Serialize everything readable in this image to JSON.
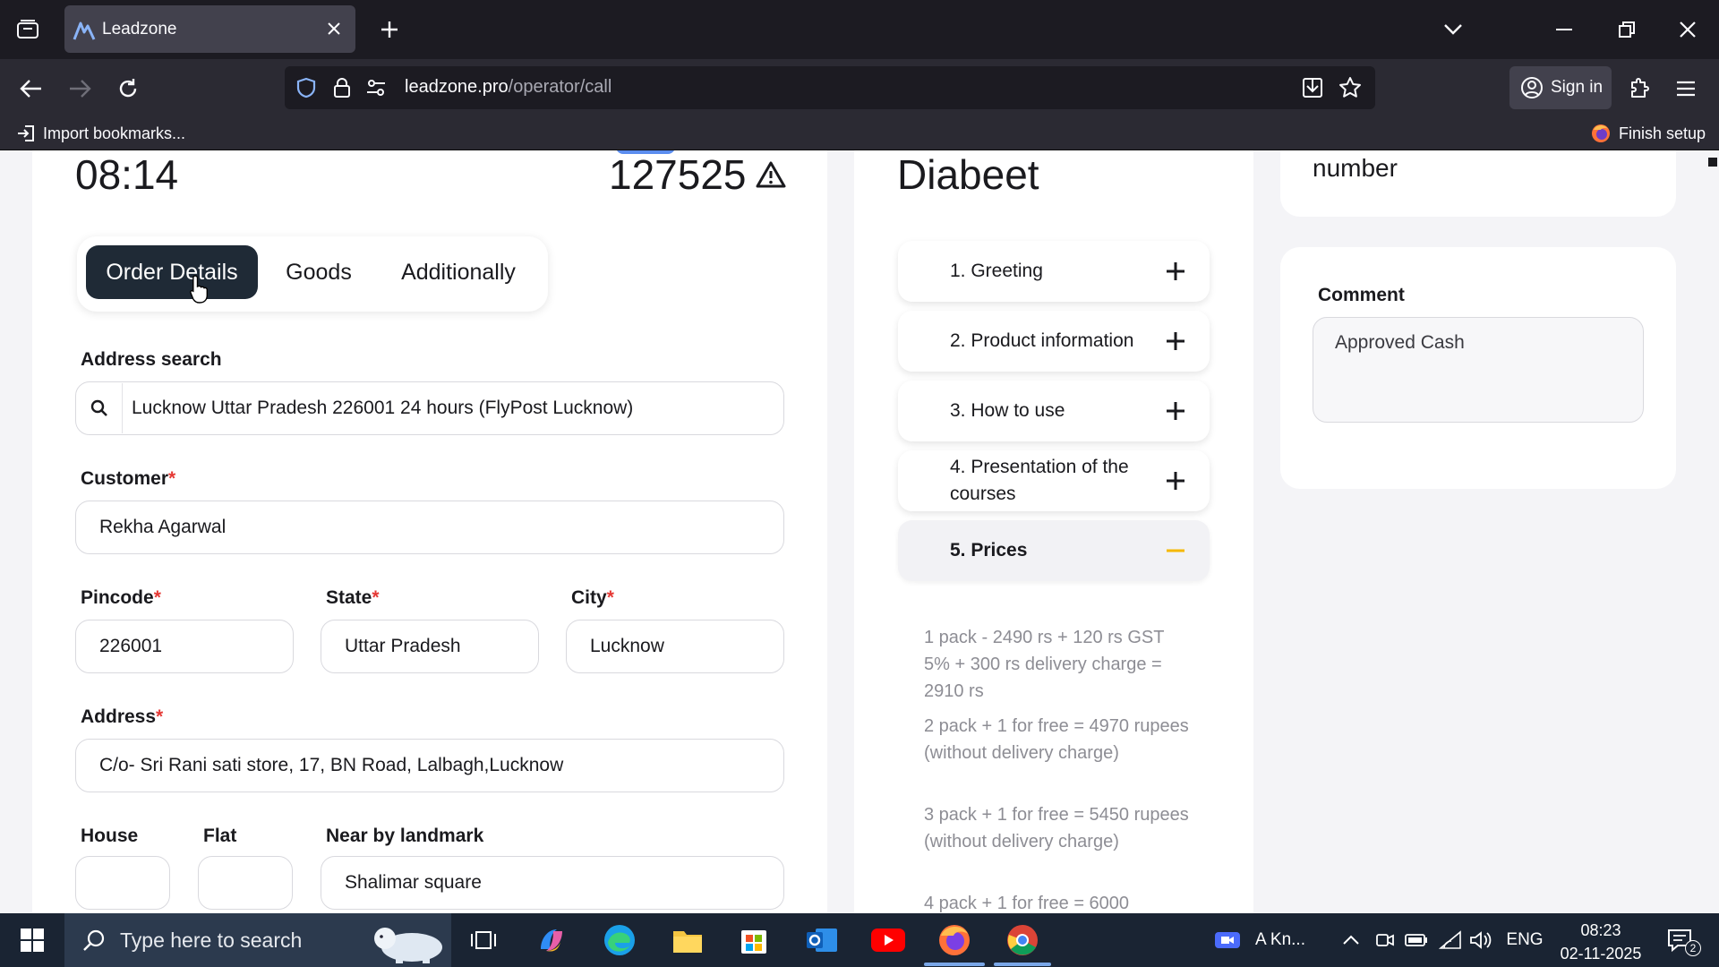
{
  "browser": {
    "tab_title": "Leadzone",
    "url_domain": "leadzone.pro",
    "url_path": "/operator/call",
    "sign_in": "Sign in",
    "bookmarks": {
      "import": "Import bookmarks...",
      "finish_setup": "Finish setup"
    }
  },
  "order": {
    "timer": "08:14",
    "order_number": "127525",
    "tabs": [
      {
        "label": "Order Details"
      },
      {
        "label": "Goods"
      },
      {
        "label": "Additionally"
      }
    ],
    "address_search": {
      "label": "Address search",
      "value": "Lucknow Uttar Pradesh 226001 24 hours (FlyPost Lucknow)"
    },
    "customer": {
      "label": "Customer",
      "value": "Rekha Agarwal"
    },
    "pincode": {
      "label": "Pincode",
      "value": "226001"
    },
    "state": {
      "label": "State",
      "value": "Uttar Pradesh"
    },
    "city": {
      "label": "City",
      "value": "Lucknow"
    },
    "address": {
      "label": "Address",
      "value": "C/o- Sri Rani sati store, 17, BN Road, Lalbagh,Lucknow"
    },
    "house": {
      "label": "House",
      "value": ""
    },
    "flat": {
      "label": "Flat",
      "value": ""
    },
    "landmark": {
      "label": "Near by landmark",
      "value": "Shalimar square"
    },
    "required_mark": "*"
  },
  "script": {
    "product": "Diabeet",
    "sections": [
      {
        "label": "1. Greeting"
      },
      {
        "label": "2. Product information"
      },
      {
        "label": "3. How to use"
      },
      {
        "label": "4. Presentation of the courses"
      },
      {
        "label": "5. Prices"
      }
    ],
    "prices": [
      "1 pack - 2490 rs + 120 rs GST 5% + 300 rs delivery charge = 2910 rs",
      "2 pack + 1 for free = 4970 rupees (without delivery charge)",
      "3 pack + 1 for free = 5450 rupees (without delivery charge)",
      "4 pack + 1 for free = 6000"
    ]
  },
  "side": {
    "number_label": "number",
    "comment": {
      "label": "Comment",
      "value": "Approved Cash"
    }
  },
  "taskbar": {
    "search_placeholder": "Type here to search",
    "zoom_label": "A Kn...",
    "language": "ENG",
    "time": "08:23",
    "date": "02-11-2025",
    "notifications": "2"
  },
  "colors": {
    "accent_dark": "#1f2a36",
    "required": "#e53935",
    "minus": "#f5b800",
    "browser_bg": "#1c1b22"
  }
}
